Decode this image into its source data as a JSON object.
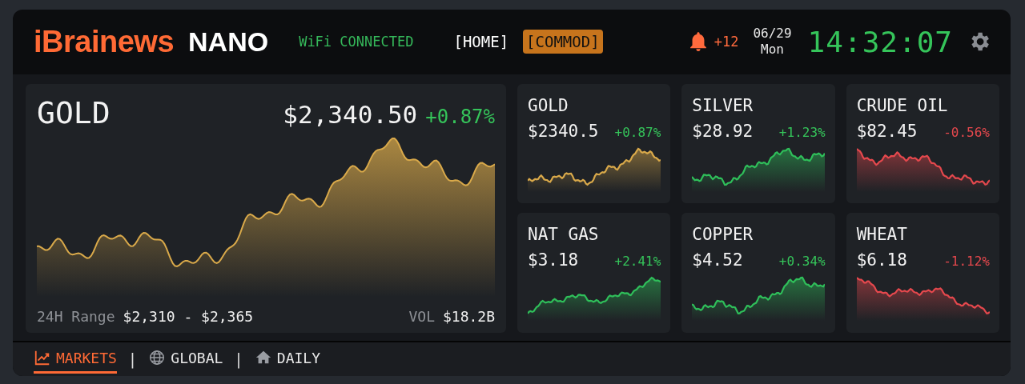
{
  "header": {
    "brand": "iBrainews",
    "model": "NANO",
    "wifi_status": "WiFi CONNECTED",
    "tabs": [
      {
        "label": "[HOME]",
        "selected": false
      },
      {
        "label": "[COMMOD]",
        "selected": true
      }
    ],
    "alerts": "+12",
    "date": "06/29",
    "weekday": "Mon",
    "clock": "14:32:07"
  },
  "featured": {
    "name": "GOLD",
    "price": "$2,340.50",
    "change": "+0.87%",
    "kind": "up",
    "color": "#d9a94a",
    "range_label": "24H Range",
    "range": "$2,310 - $2,365",
    "volume_label": "VOL",
    "volume": "$18.2B"
  },
  "tiles": [
    {
      "name": "GOLD",
      "price": "$2340.5",
      "change": "+0.87%",
      "kind": "up",
      "color": "#d9a94a"
    },
    {
      "name": "SILVER",
      "price": "$28.92",
      "change": "+1.23%",
      "kind": "up",
      "color": "#2fbf5a"
    },
    {
      "name": "CRUDE OIL",
      "price": "$82.45",
      "change": "-0.56%",
      "kind": "down",
      "color": "#e5484d"
    },
    {
      "name": "NAT GAS",
      "price": "$3.18",
      "change": "+2.41%",
      "kind": "up",
      "color": "#2fbf5a"
    },
    {
      "name": "COPPER",
      "price": "$4.52",
      "change": "+0.34%",
      "kind": "up",
      "color": "#2fbf5a"
    },
    {
      "name": "WHEAT",
      "price": "$6.18",
      "change": "-1.12%",
      "kind": "down",
      "color": "#e5484d"
    }
  ],
  "bottom_nav": [
    {
      "label": "MARKETS",
      "selected": true
    },
    {
      "label": "GLOBAL",
      "selected": false
    },
    {
      "label": "DAILY",
      "selected": false
    }
  ],
  "separator": "|"
}
